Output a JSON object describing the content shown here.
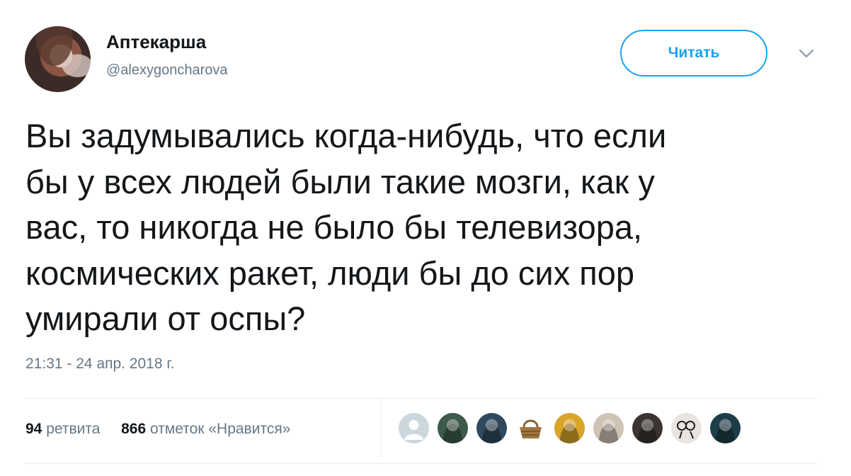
{
  "user": {
    "display_name": "Аптекарша",
    "handle": "@alexygoncharova"
  },
  "header": {
    "follow_label": "Читать",
    "menu_icon": "chevron-down-icon"
  },
  "tweet": {
    "text": "Вы задумывались когда-нибудь, что если\nбы у всех людей были такие мозги, как у\nвас, то никогда не было бы телевизора,\nкосмических ракет, люди бы до сих пор\nумирали от оспы?",
    "timestamp": "21:31 - 24 апр. 2018 г."
  },
  "stats": {
    "retweets_count": "94",
    "retweets_label": "ретвита",
    "likes_count": "866",
    "likes_label": "отметок «Нравится»"
  },
  "likers": [
    {
      "icon": "default-avatar-icon",
      "color": "#ccd6dd"
    },
    {
      "icon": "avatar-photo-icon",
      "color": "#3d5a4a"
    },
    {
      "icon": "avatar-photo-icon",
      "color": "#2f4a5e"
    },
    {
      "icon": "basket-icon",
      "color": "#a0753f"
    },
    {
      "icon": "avatar-photo-icon",
      "color": "#d8a52a"
    },
    {
      "icon": "avatar-photo-icon",
      "color": "#cfc3b3"
    },
    {
      "icon": "avatar-photo-icon",
      "color": "#3a3330"
    },
    {
      "icon": "avatar-sketch-icon",
      "color": "#e9e4df"
    },
    {
      "icon": "avatar-photo-icon",
      "color": "#1e3d4a"
    }
  ],
  "colors": {
    "accent": "#1da1f2",
    "text": "#14171a",
    "muted": "#657786",
    "divider": "#e6ecf0"
  }
}
